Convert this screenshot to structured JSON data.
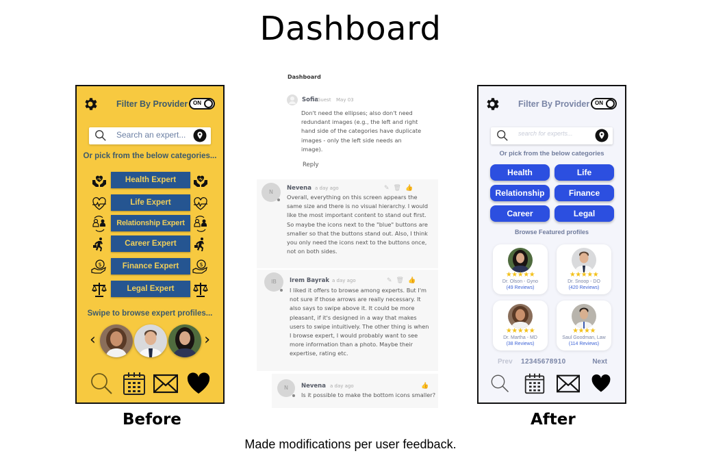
{
  "page": {
    "title": "Dashboard",
    "before_caption": "Before",
    "after_caption": "After",
    "footnote": "Made modifications per user feedback."
  },
  "before": {
    "filter_label": "Filter By Provider",
    "toggle_label": "ON",
    "search_placeholder": "Search an expert...",
    "pick_label": "Or pick from the below categories...",
    "categories": [
      {
        "label": "Health Expert",
        "icon": "heart-hands-icon"
      },
      {
        "label": "Life Expert",
        "icon": "heartbeat-icon"
      },
      {
        "label": "Relationship Expert",
        "icon": "people-exchange-icon"
      },
      {
        "label": "Career Expert",
        "icon": "businessman-running-icon"
      },
      {
        "label": "Finance Expert",
        "icon": "coin-hand-icon"
      },
      {
        "label": "Legal Expert",
        "icon": "scales-icon"
      }
    ],
    "swipe_label": "Swipe to browse expert profiles...",
    "prev_arrow": "‹",
    "next_arrow": "›",
    "colors": {
      "background": "#f7c940",
      "button": "#255591",
      "button_text": "#f0cf5a",
      "label": "#3d5a6b"
    }
  },
  "after": {
    "filter_label": "Filter By Provider",
    "toggle_label": "ON",
    "search_placeholder": "search for experts...",
    "pick_label": "Or pick from the below categories",
    "categories": [
      "Health",
      "Life",
      "Relationship",
      "Finance",
      "Career",
      "Legal"
    ],
    "browse_label": "Browse Featured profiles",
    "profiles": [
      {
        "name": "Dr. Olson - Gyno",
        "reviews": "(49 Reviews)",
        "stars": "★★★★★"
      },
      {
        "name": "Dr. Snoop - DO",
        "reviews": "(420 Reviews)",
        "stars": "★★★★★"
      },
      {
        "name": "Dr. Martha - MD",
        "reviews": "(38 Reviews)",
        "stars": "★★★★★"
      },
      {
        "name": "Saul Goodman, Law",
        "reviews": "(114 Reviews)",
        "stars": "★★★★"
      }
    ],
    "pager": {
      "prev": "Prev",
      "pages": "12345678910",
      "next": "Next"
    },
    "colors": {
      "background": "#f4f5fb",
      "button": "#2c4fe0",
      "star": "#f3c11b",
      "link": "#3d63d6"
    }
  },
  "comments": {
    "title": "Dashboard",
    "items": [
      {
        "avatar": "",
        "author": "Sofia",
        "role": "Guest",
        "date": "May 03",
        "lines": [
          "Don't need the ellipses; also don't need",
          "redundant images (e.g., the left and right",
          "hand side of the categories have duplicate",
          "images - only the left side needs an",
          "image)."
        ],
        "reply": "Reply"
      },
      {
        "avatar": "N",
        "author": "Nevena",
        "date": "a day ago",
        "lines": [
          "Overall, everything on this screen appears the",
          "same size and there is no visual hierarchy. I would",
          "like the most important content to stand out first.",
          "So maybe the icons next to the \"blue\" buttons are",
          "smaller so that the buttons stand out. Also, I think",
          "you only need the icons next to the buttons once,",
          "not on both sides."
        ]
      },
      {
        "avatar": "IB",
        "author": "Irem Bayrak",
        "date": "a day ago",
        "lines": [
          "I liked it offers to browse among experts. But I'm",
          "not sure if those arrows are really necessary. It",
          "also says to swipe above it. It could be more",
          "pleasant, if it's designed in a way that makes",
          "users to swipe intuitively. The other thing is when",
          "I browse expert, I would probably want to see",
          "more information than a photo. Maybe their",
          "expertise, rating etc."
        ]
      },
      {
        "avatar": "N",
        "author": "Nevena",
        "date": "a day ago",
        "lines": [
          "Is it possible to make the bottom icons smaller?"
        ]
      }
    ]
  }
}
